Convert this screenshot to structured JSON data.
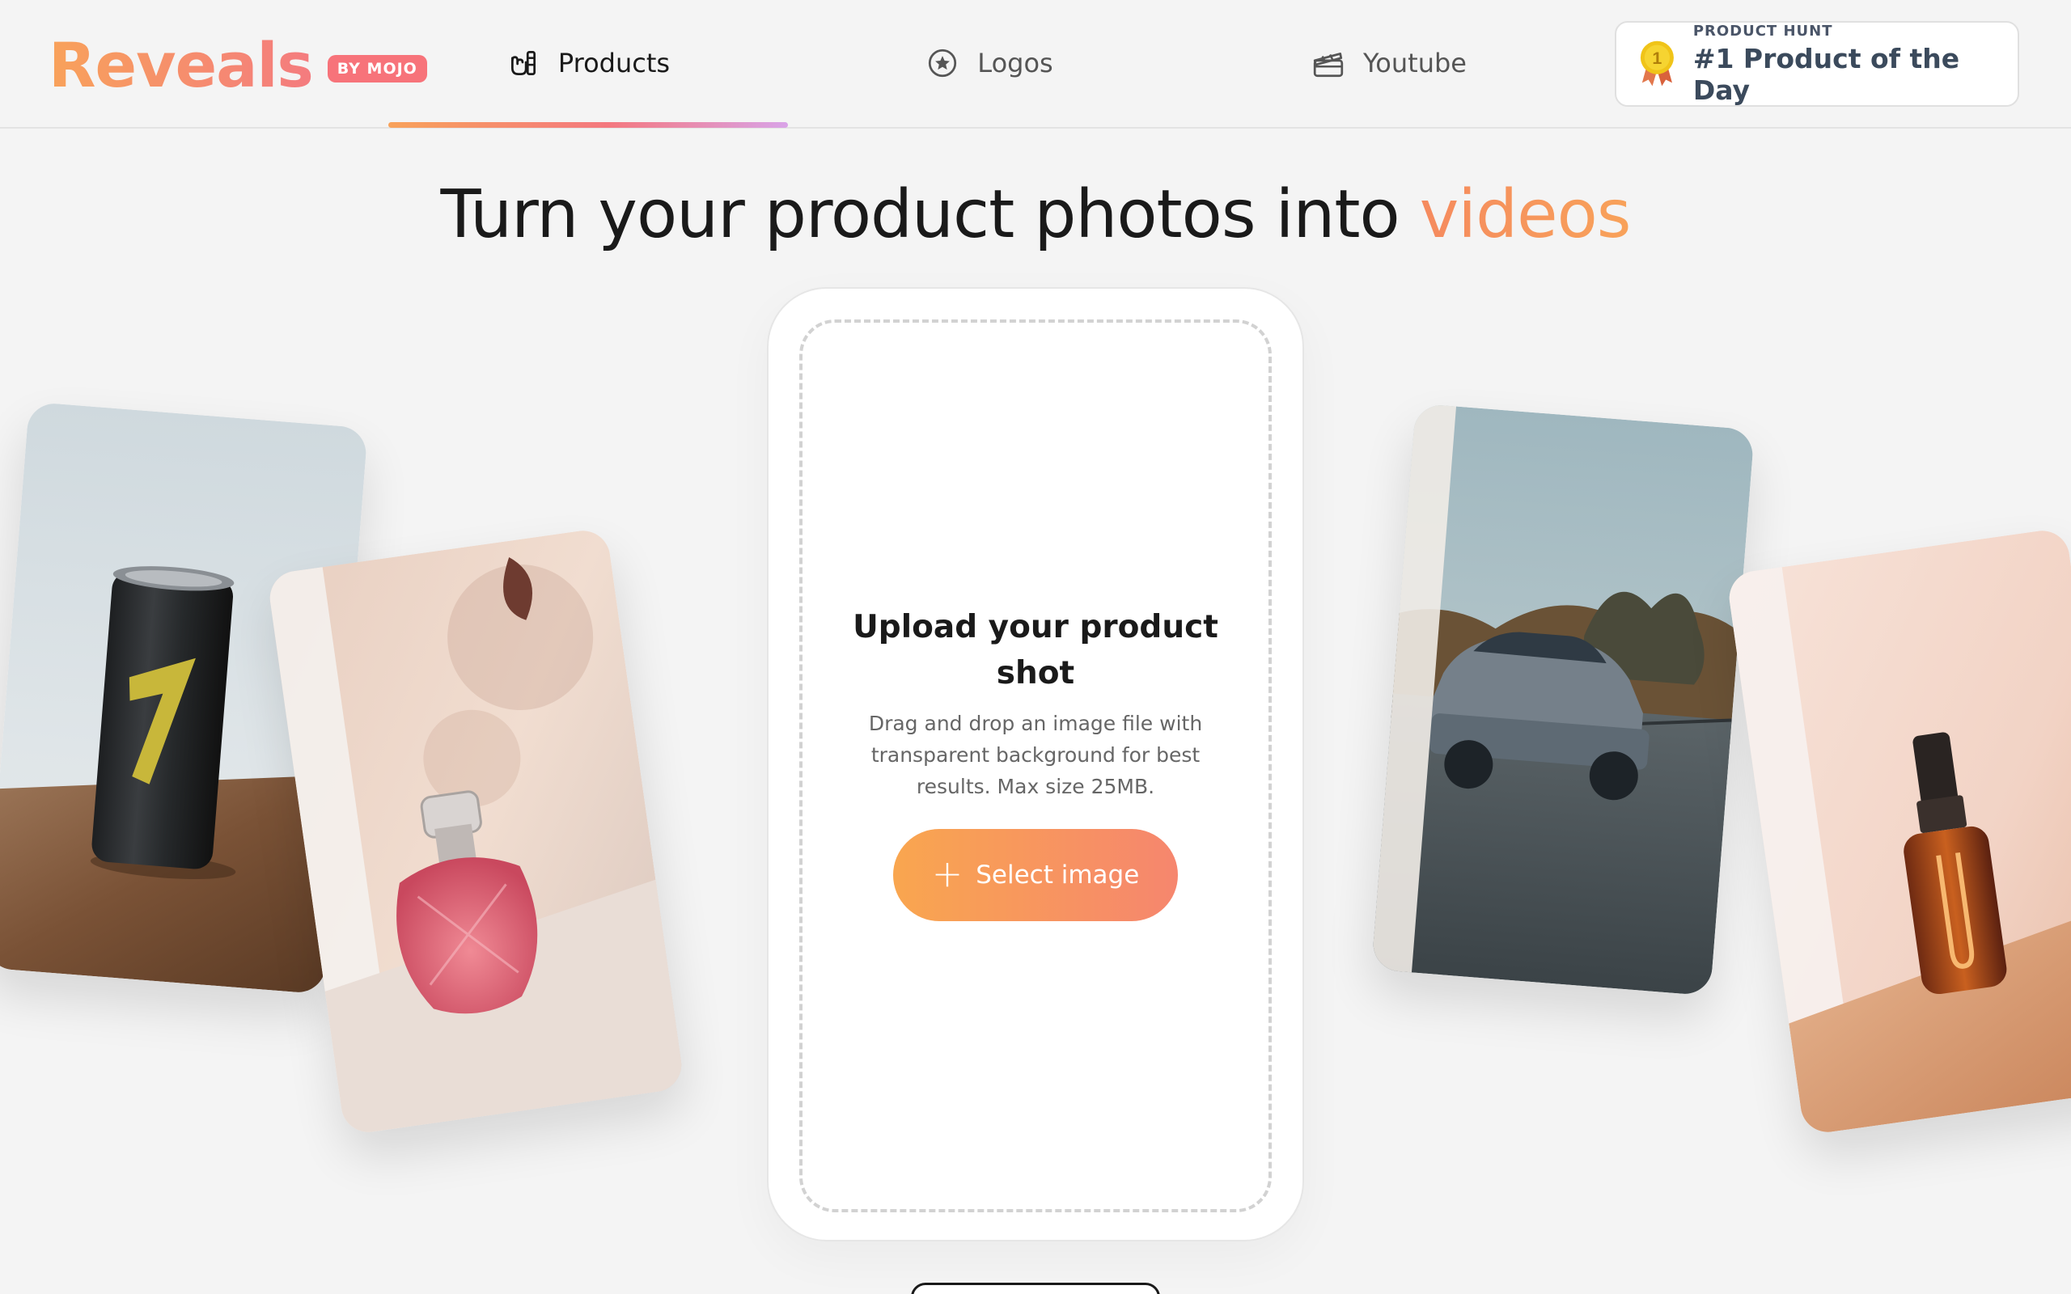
{
  "brand": {
    "name": "Reveals",
    "badge": "BY MOJO"
  },
  "nav": {
    "tabs": [
      {
        "label": "Products",
        "icon": "hand-bottle-icon",
        "active": true
      },
      {
        "label": "Logos",
        "icon": "star-circle-icon",
        "active": false
      },
      {
        "label": "Youtube",
        "icon": "clapperboard-icon",
        "active": false
      }
    ]
  },
  "product_hunt": {
    "kicker": "PRODUCT HUNT",
    "title": "#1 Product of the Day",
    "medal": "1"
  },
  "hero": {
    "title_prefix": "Turn your product photos into",
    "title_accent": "videos"
  },
  "upload": {
    "heading": "Upload your product shot",
    "description": "Drag and drop an image file with transparent background for best results. Max size 25MB.",
    "button_label": "Select image",
    "button_icon": "plus-icon"
  },
  "colors": {
    "accent_orange": "#f8a25a",
    "accent_pink": "#f4787f",
    "badge_pink": "#f7737a",
    "ph_text": "#3b4a5c"
  },
  "showcase": [
    {
      "name": "energy-drink-can-photo"
    },
    {
      "name": "perfume-bottle-photo"
    },
    {
      "name": "car-photo"
    },
    {
      "name": "serum-bottle-photo"
    }
  ]
}
